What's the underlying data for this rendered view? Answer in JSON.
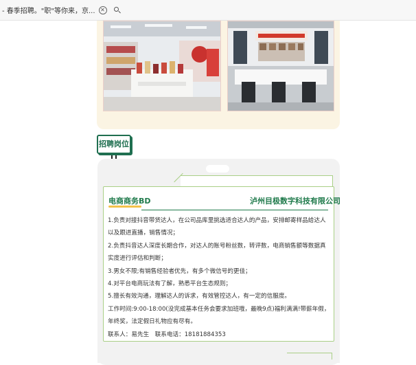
{
  "browser": {
    "tab_title": "- 春季招聘。\"职\"等你来，京...",
    "close_symbol": "✕"
  },
  "photos": [
    {
      "name": "store-display-photo",
      "description_icon": "shelves-photo"
    },
    {
      "name": "office-meeting-photo",
      "description_icon": "meeting-room-photo"
    }
  ],
  "section": {
    "badge_label": "招聘岗位"
  },
  "job": {
    "title": "电商商务BD",
    "company": "泸州目极数字科技有限公司",
    "lines": [
      "1.负责对接抖音带货达人，在公司品库里挑选适合达人的产品，安排邮寄样品给达人以及跟进直播，销售情况；",
      "2.负责抖音达人深度长期合作，对达人的账号粉丝数，转评数，电商销售额等数据真实度进行评估和判断；",
      "3.男女不限;有销售经验者优先，有多个微信号的更佳；",
      "4.对平台电商玩法有了解，熟悉平台生态规则；",
      "5.擅长有效沟通，理解达人的诉求，有效管控达人，有一定的信服度。",
      "工作时间:9:00-18:00(没完成基本任务会要求加班哦，最晚9点)福利满满!带薪年假，年终奖，法定假日礼物应有尽有。",
      "联系人：易先生　联系电话：18181884353"
    ]
  },
  "colors": {
    "accent_green": "#1f7a4b",
    "underline_yellow": "#f3c24a",
    "panel_cream": "#fbf4e3",
    "card_border": "#a9cf86"
  }
}
